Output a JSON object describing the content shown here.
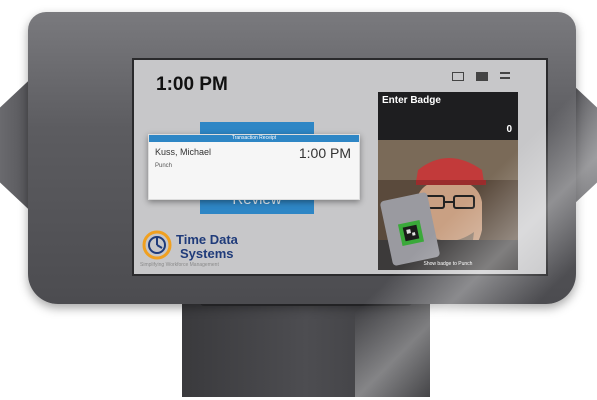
{
  "header": {
    "time": "1:00 PM",
    "icons": [
      "battery-icon",
      "mail-icon",
      "menu-icon"
    ]
  },
  "receipt": {
    "title": "Transaction Receipt",
    "employee_name": "Kuss, Michael",
    "action": "Punch",
    "time": "1:00 PM"
  },
  "review": {
    "label": "Review"
  },
  "logo": {
    "name_line1": "Time Data",
    "name_line2": "Systems",
    "tagline": "Simplifying Workforce Management"
  },
  "badge": {
    "title": "Enter Badge",
    "count": "0"
  },
  "camera": {
    "caption": "Show badge to Punch"
  },
  "colors": {
    "accent_blue": "#2e86c5",
    "logo_navy": "#1f3b7a",
    "logo_orange": "#f0a020",
    "panel_dark": "#1e1e20"
  }
}
